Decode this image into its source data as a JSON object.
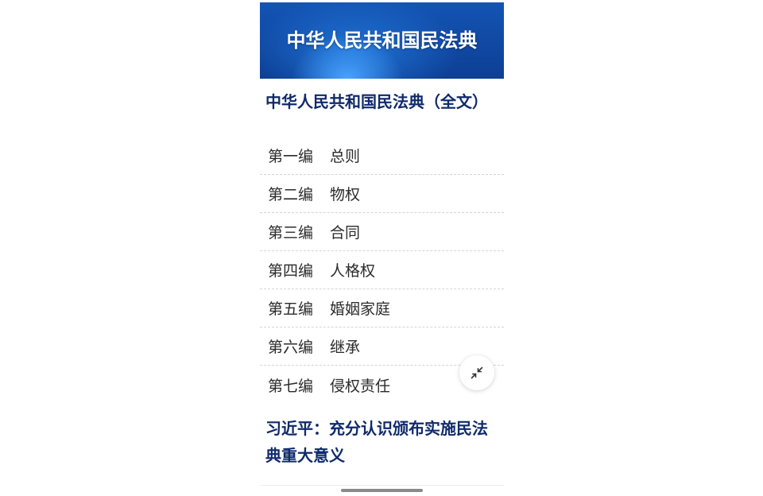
{
  "banner": {
    "title": "中华人民共和国民法典"
  },
  "heading": "中华人民共和国民法典（全文）",
  "toc": [
    {
      "part": "第一编",
      "title": "总则"
    },
    {
      "part": "第二编",
      "title": "物权"
    },
    {
      "part": "第三编",
      "title": "合同"
    },
    {
      "part": "第四编",
      "title": "人格权"
    },
    {
      "part": "第五编",
      "title": "婚姻家庭"
    },
    {
      "part": "第六编",
      "title": "继承"
    },
    {
      "part": "第七编",
      "title": "侵权责任"
    }
  ],
  "related_article": {
    "title": "习近平：充分认识颁布实施民法典重大意义"
  },
  "floating_button": {
    "icon": "collapse-arrows-icon"
  },
  "colors": {
    "banner_blue": "#1454b4",
    "heading_navy": "#0f2a6b"
  }
}
